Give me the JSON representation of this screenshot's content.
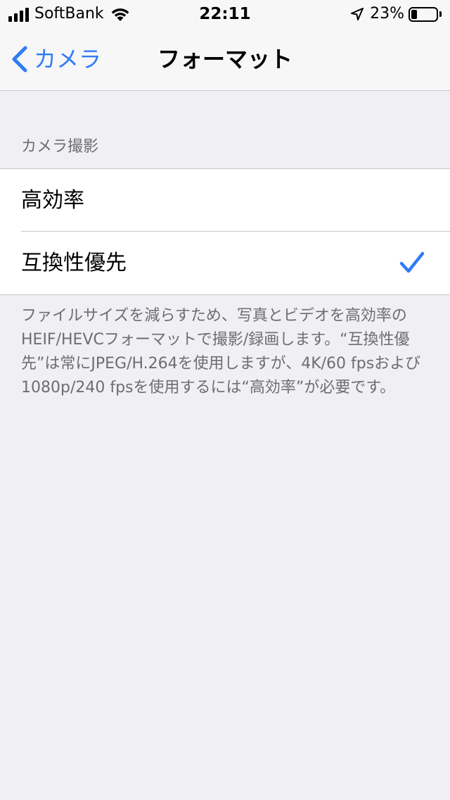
{
  "status_bar": {
    "carrier": "SoftBank",
    "time": "22:11",
    "battery_percent": "23%",
    "battery_level": 0.23
  },
  "nav": {
    "back_label": "カメラ",
    "title": "フォーマット"
  },
  "section": {
    "header": "カメラ撮影",
    "options": [
      {
        "label": "高効率",
        "selected": false
      },
      {
        "label": "互換性優先",
        "selected": true
      }
    ],
    "footer": "ファイルサイズを減らすため、写真とビデオを高効率のHEIF/HEVCフォーマットで撮影/録画します。“互換性優先”は常にJPEG/H.264を使用しますが、4K/60 fpsおよび1080p/240 fpsを使用するには“高効率”が必要です。"
  },
  "colors": {
    "accent": "#2f7cf6",
    "background": "#efeff4"
  }
}
